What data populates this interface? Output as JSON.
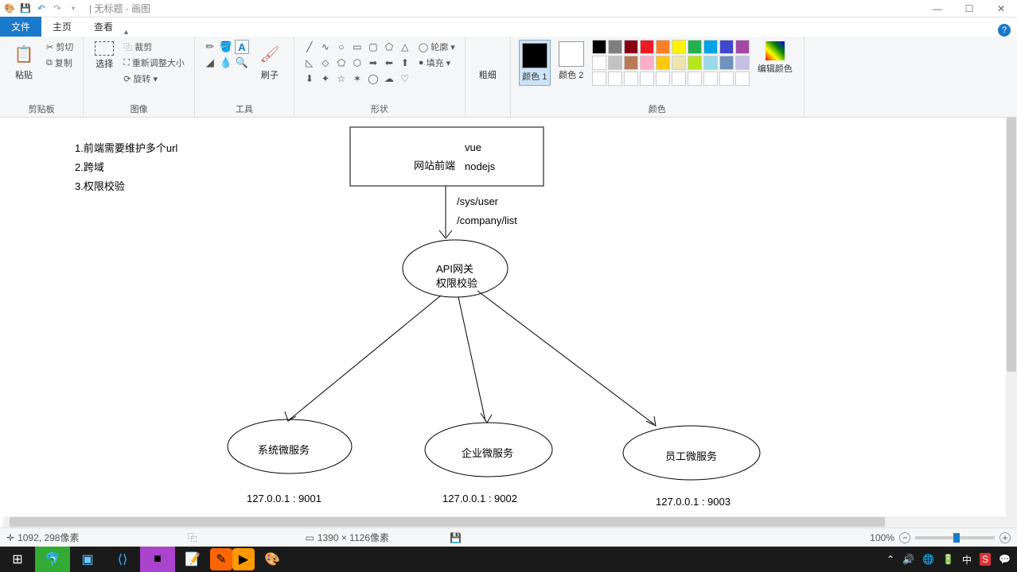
{
  "window": {
    "title": "无标题 - 画图",
    "qat": {
      "save": "💾",
      "undo": "↶",
      "redo": "↷"
    }
  },
  "tabs": {
    "file": "文件",
    "home": "主页",
    "view": "查看"
  },
  "ribbon": {
    "clipboard": {
      "label": "剪贴板",
      "paste": "粘贴",
      "cut": "剪切",
      "copy": "复制"
    },
    "image": {
      "label": "图像",
      "select": "选择",
      "crop": "裁剪",
      "resize": "重新调整大小",
      "rotate": "旋转"
    },
    "tools": {
      "label": "工具",
      "brush": "刷子"
    },
    "shapes": {
      "label": "形状",
      "outline": "轮廓",
      "fill": "填充"
    },
    "thickness": {
      "label": "粗细"
    },
    "color1": {
      "label": "颜色 1"
    },
    "color2": {
      "label": "颜色 2"
    },
    "colors": {
      "label": "颜色",
      "edit": "编辑颜色"
    }
  },
  "palette": {
    "row1": [
      "#000000",
      "#7f7f7f",
      "#880015",
      "#ed1c24",
      "#ff7f27",
      "#fff200",
      "#22b14c",
      "#00a2e8",
      "#3f48cc",
      "#a349a4"
    ],
    "row2": [
      "#ffffff",
      "#c3c3c3",
      "#b97a57",
      "#ffaec9",
      "#ffc90e",
      "#efe4b0",
      "#b5e61d",
      "#99d9ea",
      "#7092be",
      "#c8bfe7"
    ],
    "row3": [
      "#ffffff",
      "#ffffff",
      "#ffffff",
      "#ffffff",
      "#ffffff",
      "#ffffff",
      "#ffffff",
      "#ffffff",
      "#ffffff",
      "#ffffff"
    ]
  },
  "selected_colors": {
    "primary": "#000000",
    "secondary": "#ffffff"
  },
  "diagram": {
    "notes": [
      "1.前端需要维护多个url",
      "2.跨域",
      "3.权限校验"
    ],
    "frontend": {
      "title": "网站前端",
      "tech1": "vue",
      "tech2": "nodejs"
    },
    "paths": [
      "/sys/user",
      "/company/list"
    ],
    "gateway": {
      "line1": "API网关",
      "line2": "权限校验"
    },
    "services": [
      {
        "name": "系统微服务",
        "addr": "127.0.0.1 : 9001"
      },
      {
        "name": "企业微服务",
        "addr": "127.0.0.1 : 9002"
      },
      {
        "name": "员工微服务",
        "addr": "127.0.0.1 : 9003"
      }
    ]
  },
  "status": {
    "coords": "1092, 298像素",
    "canvas_size": "1390 × 1126像素",
    "zoom": "100%"
  },
  "tray": {
    "time": "中"
  }
}
